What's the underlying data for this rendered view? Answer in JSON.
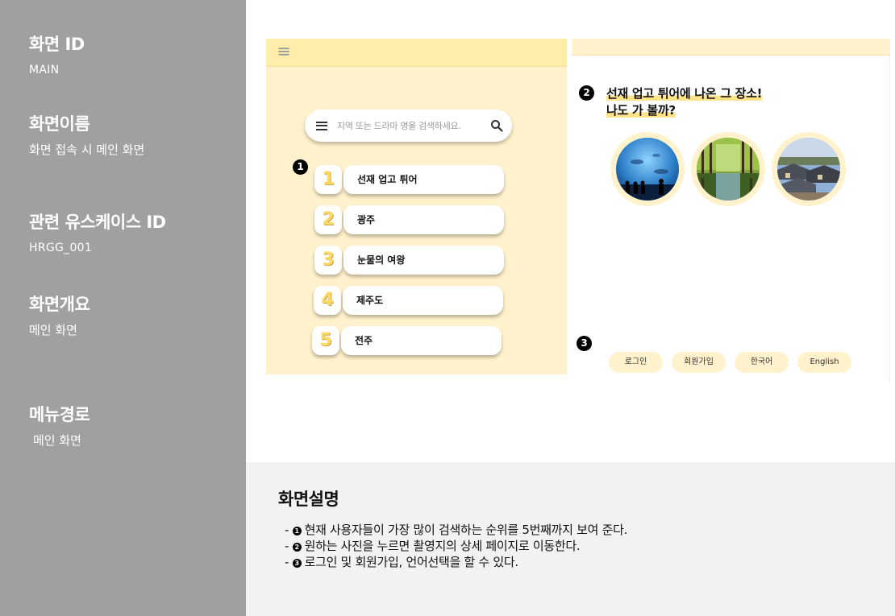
{
  "sidebar": {
    "screen_id": {
      "heading": "화면 ID",
      "value": "MAIN"
    },
    "screen_name": {
      "heading": "화면이름",
      "value": "화면 접속 시 메인 화면"
    },
    "usecase_id": {
      "heading": "관련 유스케이스 ID",
      "value": "HRGG_001"
    },
    "overview": {
      "heading": "화면개요",
      "value": "메인 화면"
    },
    "menu_path": {
      "heading": "메뉴경로",
      "value": "메인 화면"
    }
  },
  "markers": {
    "one": "1",
    "two": "2",
    "three": "3"
  },
  "screen1": {
    "search_placeholder": "지역 또는 드라마 명을 검색하세요.",
    "ranking": [
      {
        "rank": "1",
        "label": "선재 업고 튀어"
      },
      {
        "rank": "2",
        "label": "광주"
      },
      {
        "rank": "3",
        "label": "눈물의 여왕"
      },
      {
        "rank": "4",
        "label": "제주도"
      },
      {
        "rank": "5",
        "label": "전주"
      }
    ]
  },
  "screen2": {
    "promo_line1": "선재 업고 튀어에 나온 그 장소!",
    "promo_line2": "나도 가 볼까?",
    "footer_buttons": [
      "로그인",
      "회원가입",
      "한국어",
      "English"
    ]
  },
  "description": {
    "title": "화면설명",
    "items": [
      {
        "marker": "1",
        "text": "현재 사용자들이 가장 많이 검색하는 순위를 5번째까지 보여 준다."
      },
      {
        "marker": "2",
        "text": "원하는 사진을 누르면 촬영지의 상세 페이지로 이동한다."
      },
      {
        "marker": "3",
        "text": "로그인 및 회원가입, 언어선택을 할 수 있다."
      }
    ]
  },
  "colors": {
    "sidebar_bg": "#a0a0a0",
    "screen_bg": "#fff2cc",
    "accent_yellow": "#ffd966",
    "desc_bg": "#f2f2f2"
  },
  "icons": [
    "hamburger-icon",
    "search-icon"
  ]
}
